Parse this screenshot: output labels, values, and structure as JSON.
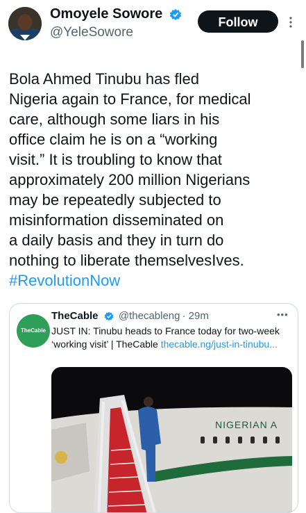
{
  "tweet": {
    "author_name": "Omoyele Sowore",
    "author_handle": "@YeleSowore",
    "follow_label": "Follow",
    "body": "Bola Ahmed Tinubu has fled\nNigeria again to France, for medical\ncare, although some liars in his\noffice  claim he is on a “working\nvisit.” It is troubling to know that\napproximately 200 million Nigerians\nmay be repeatedly subjected to\nmisinformation disseminated on\na daily basis and they in turn do\nnothing to liberate themselvesIves.",
    "hashtag": "#RevolutionNow",
    "verified_color": "#1d9bf0"
  },
  "quoted": {
    "avatar_text": "TheCable",
    "author_name": "TheCable",
    "author_handle": "@thecableng",
    "time": "· 29m",
    "text": "JUST IN: Tinubu heads to France today for two-week ‘working visit’ | TheCable ",
    "link": "thecable.ng/just-in-tinubu...",
    "brand_color": "#2f9e58",
    "photo": {
      "plane_text": "NIGERIAN A"
    }
  }
}
